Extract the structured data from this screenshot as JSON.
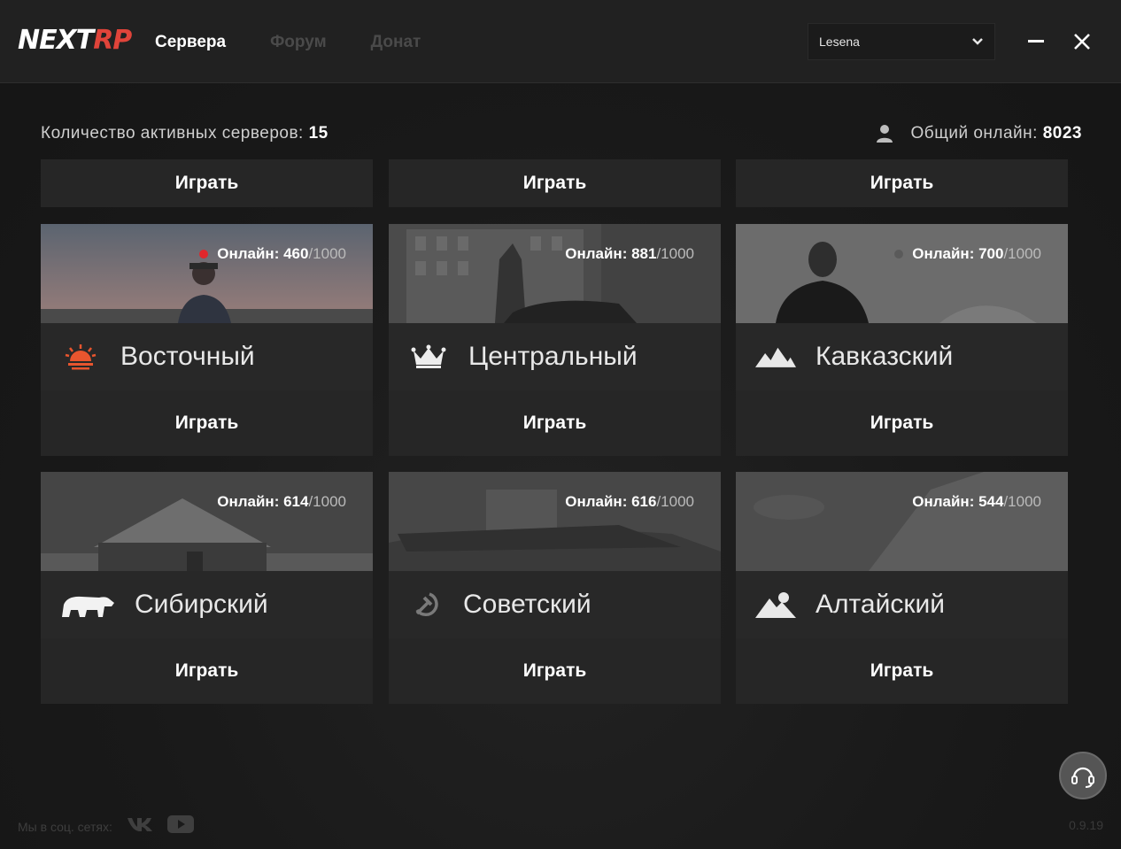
{
  "app": {
    "logo_part1": "NEXT",
    "logo_part2": "RP"
  },
  "nav": {
    "servers": "Сервера",
    "forum": "Форум",
    "donate": "Донат"
  },
  "account": {
    "selected": "Lesena"
  },
  "stats": {
    "active_label": "Количество активных серверов:",
    "active_count": "15",
    "online_label": "Общий онлайн:",
    "online_count": "8023"
  },
  "play_label": "Играть",
  "partial_row": [
    "Играть",
    "Играть",
    "Играть"
  ],
  "servers": [
    {
      "name": "Восточный",
      "online": "Онлайн: 460",
      "max": "/1000",
      "icon": "sunrise-icon",
      "dot": "#e0262b"
    },
    {
      "name": "Центральный",
      "online": "Онлайн: 881",
      "max": "/1000",
      "icon": "crown-icon",
      "dot": ""
    },
    {
      "name": "Кавказский",
      "online": "Онлайн: 700",
      "max": "/1000",
      "icon": "mountains-icon",
      "dot": "#5a5a5a"
    },
    {
      "name": "Сибирский",
      "online": "Онлайн: 614",
      "max": "/1000",
      "icon": "polar-bear-icon",
      "dot": ""
    },
    {
      "name": "Советский",
      "online": "Онлайн: 616",
      "max": "/1000",
      "icon": "hammer-sickle-icon",
      "dot": ""
    },
    {
      "name": "Алтайский",
      "online": "Онлайн: 544",
      "max": "/1000",
      "icon": "mountain-moon-icon",
      "dot": ""
    }
  ],
  "footer": {
    "social_label": "Мы в соц. сетях:",
    "version": "0.9.19"
  },
  "colors": {
    "brand_red": "#e0443a",
    "accent_orange": "#e8552e"
  }
}
